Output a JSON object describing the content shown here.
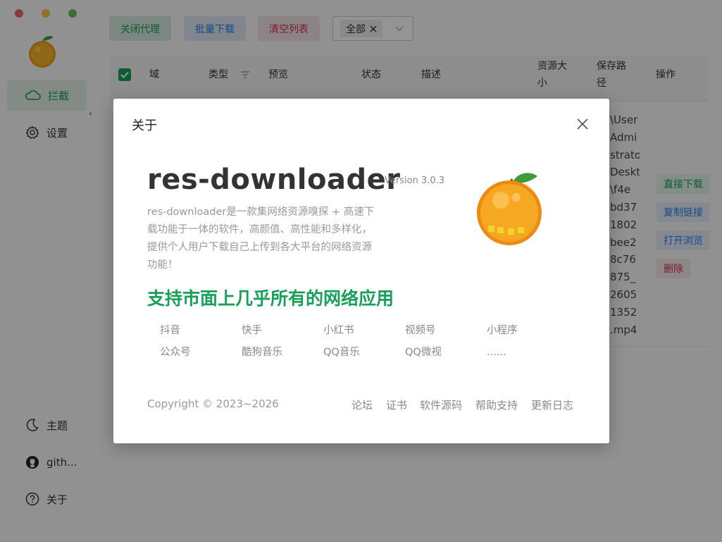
{
  "toolbar": {
    "close_proxy": "关闭代理",
    "batch_download": "批量下载",
    "clear_list": "清空列表",
    "filter_tag": "全部"
  },
  "sidebar": {
    "items": [
      {
        "label": "拦截",
        "icon": "cloud-icon"
      },
      {
        "label": "设置",
        "icon": "gear-icon"
      },
      {
        "label": "主题",
        "icon": "moon-icon"
      },
      {
        "label": "gith...",
        "icon": "github-icon"
      },
      {
        "label": "关于",
        "icon": "help-circle-icon"
      }
    ]
  },
  "table": {
    "columns": [
      "域",
      "类型",
      "预览",
      "状态",
      "描述",
      "资源大小",
      "保存路径",
      "操作"
    ],
    "path_lines": [
      "\\User",
      "Admi",
      "strato",
      "Deskt",
      "\\f4e",
      "bd37",
      "1802",
      "bee2",
      "8c76",
      "875_",
      "2605",
      "1352",
      ".mp4"
    ],
    "actions": [
      "直接下载",
      "复制链接",
      "打开浏览",
      "删除"
    ]
  },
  "modal": {
    "title": "关于",
    "app_name": "res-downloader",
    "version": "Version 3.0.3",
    "description_lines": [
      "res-downloader是一款集网络资源嗅探 + 高速下",
      "载功能于一体的软件，高颜值、高性能和多样化，",
      "提供个人用户下载自己上传到各大平台的网络资源",
      "功能！"
    ],
    "support_text": "支持市面上几乎所有的网络应用",
    "platforms": [
      "抖音",
      "快手",
      "小红书",
      "视频号",
      "小程序",
      "公众号",
      "酷狗音乐",
      "QQ音乐",
      "QQ微视",
      "......"
    ],
    "copyright": "Copyright © 2023~2026",
    "links": [
      "论坛",
      "证书",
      "软件源码",
      "帮助支持",
      "更新日志"
    ]
  },
  "colors": {
    "accent_green": "#18a058",
    "accent_blue": "#2080f0",
    "accent_red": "#d03050"
  }
}
